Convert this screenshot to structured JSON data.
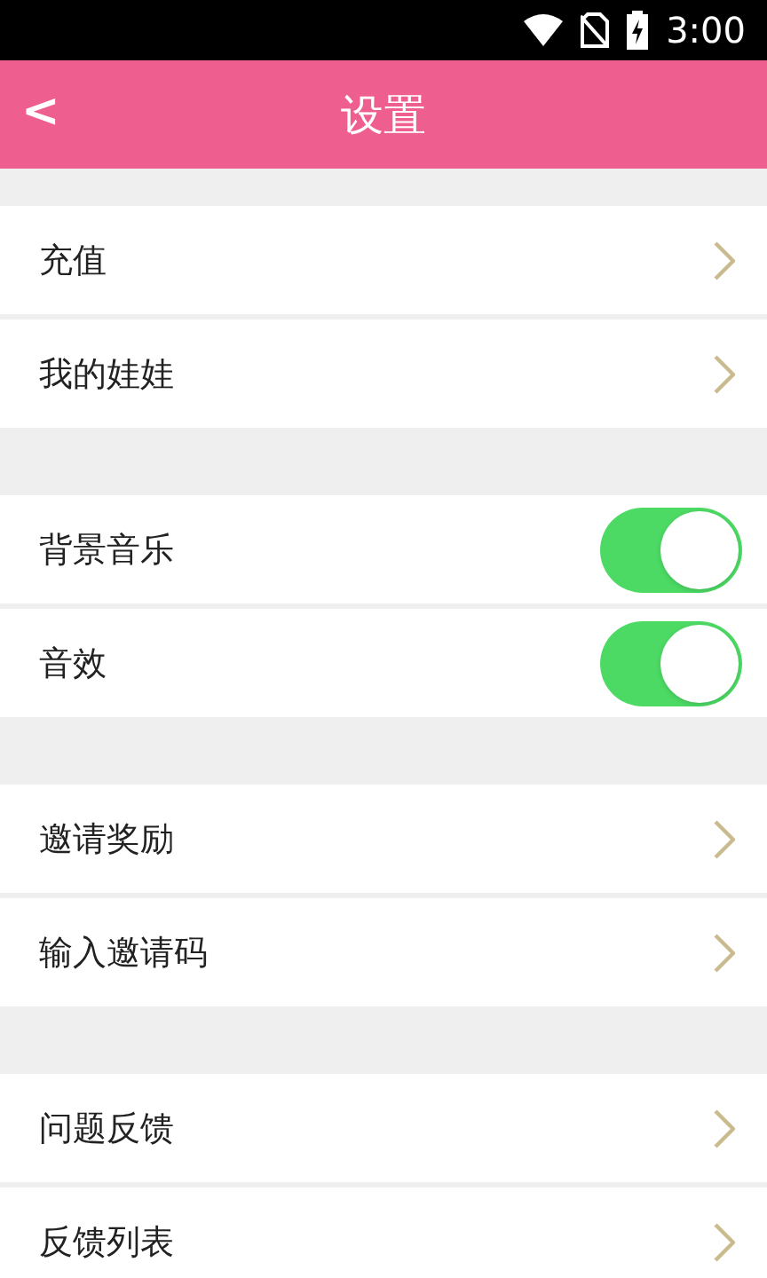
{
  "status_bar": {
    "time": "3:00"
  },
  "header": {
    "back": "<",
    "title": "设置"
  },
  "sections": [
    {
      "items": [
        {
          "kind": "link",
          "label": "充值"
        },
        {
          "kind": "link",
          "label": "我的娃娃"
        }
      ]
    },
    {
      "items": [
        {
          "kind": "toggle",
          "label": "背景音乐",
          "on": true
        },
        {
          "kind": "toggle",
          "label": "音效",
          "on": true
        }
      ]
    },
    {
      "items": [
        {
          "kind": "link",
          "label": "邀请奖励"
        },
        {
          "kind": "link",
          "label": "输入邀请码"
        }
      ]
    },
    {
      "items": [
        {
          "kind": "link",
          "label": "问题反馈"
        },
        {
          "kind": "link",
          "label": "反馈列表"
        }
      ]
    }
  ]
}
